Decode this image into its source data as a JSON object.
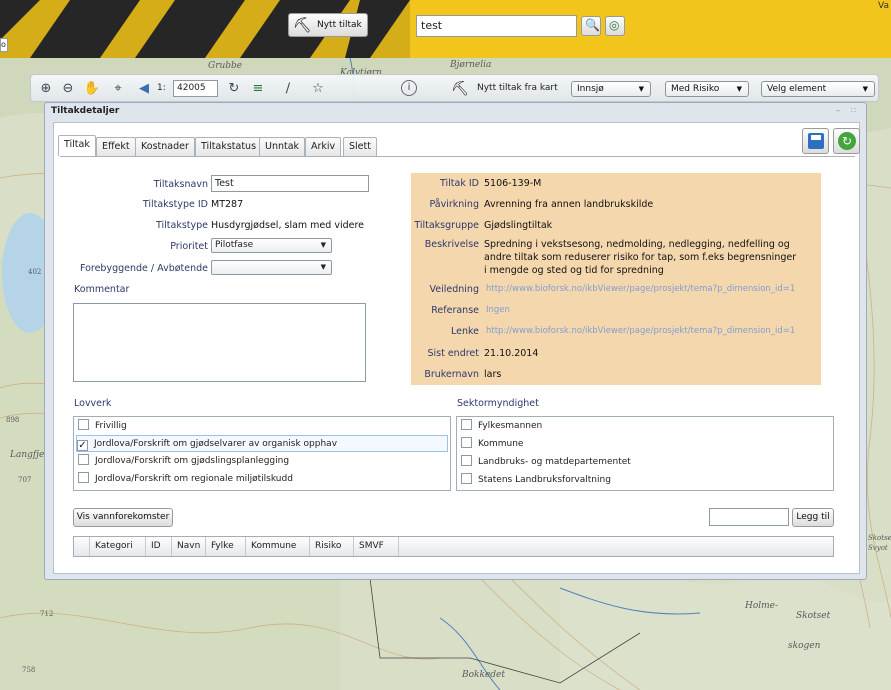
{
  "topbar": {
    "nytt_tiltak_label": "Nytt tiltak",
    "search_value": "test",
    "corner_text": "Va",
    "left_edge_text": "o"
  },
  "toolbar": {
    "scale_prefix": "1:",
    "scale_value": "42005",
    "nytt_tiltak_fra_kart_label": "Nytt tiltak fra kart",
    "dropdown_waterbody": "Innsjø",
    "dropdown_risk": "Med Risiko",
    "dropdown_element": "Velg element"
  },
  "map_labels": [
    "Grubbe",
    "Kalvtjørn",
    "Bjørnelia",
    "402",
    "898",
    "Langfjellet",
    "707",
    "Holme-",
    "Skotset",
    "skogen",
    "Bokkedet",
    "712",
    "758",
    "Skotsel",
    "Svyot"
  ],
  "panel": {
    "title": "Tiltakdetaljer",
    "tabs": [
      "Tiltak",
      "Effekt",
      "Kostnader",
      "Tiltakstatus",
      "Unntak",
      "Arkiv",
      "Slett"
    ]
  },
  "form": {
    "tiltaksnavn_label": "Tiltaksnavn",
    "tiltaksnavn_value": "Test",
    "tiltakstype_id_label": "Tiltakstype ID",
    "tiltakstype_id_value": "MT287",
    "tiltakstype_label": "Tiltakstype",
    "tiltakstype_value": "Husdyrgjødsel, slam med videre",
    "prioritet_label": "Prioritet",
    "prioritet_value": "Pilotfase",
    "forebyggende_label": "Forebyggende / Avbøtende",
    "forebyggende_value": "",
    "kommentar_label": "Kommentar"
  },
  "info": {
    "tiltak_id_label": "Tiltak ID",
    "tiltak_id_value": "5106-139-M",
    "pavirkning_label": "Påvirkning",
    "pavirkning_value": "Avrenning fra annen landbrukskilde",
    "tiltaksgruppe_label": "Tiltaksgruppe",
    "tiltaksgruppe_value": "Gjødslingtiltak",
    "beskrivelse_label": "Beskrivelse",
    "beskrivelse_line1": "Spredning i vekstsesong, nedmolding, nedlegging, nedfelling og",
    "beskrivelse_line2": "andre tiltak som reduserer risiko for tap, som f.eks begrensninger",
    "beskrivelse_line3": "i mengde og sted og tid for spredning",
    "veiledning_label": "Veiledning",
    "veiledning_value": "http://www.bioforsk.no/ikbViewer/page/prosjekt/tema?p_dimension_id=1",
    "referanse_label": "Referanse",
    "referanse_value": "Ingen",
    "lenke_label": "Lenke",
    "lenke_value": "http://www.bioforsk.no/ikbViewer/page/prosjekt/tema?p_dimension_id=1",
    "sist_endret_label": "Sist endret",
    "sist_endret_value": "21.10.2014",
    "brukernavn_label": "Brukernavn",
    "brukernavn_value": "lars"
  },
  "lovverk": {
    "title": "Lovverk",
    "items": [
      {
        "label": "Frivillig",
        "checked": false
      },
      {
        "label": "Jordlova/Forskrift om gjødselvarer av organisk opphav",
        "checked": true
      },
      {
        "label": "Jordlova/Forskrift om gjødslingsplanlegging",
        "checked": false
      },
      {
        "label": "Jordlova/Forskrift om regionale miljøtilskudd",
        "checked": false
      }
    ]
  },
  "sektor": {
    "title": "Sektormyndighet",
    "items": [
      {
        "label": "Fylkesmannen",
        "checked": false
      },
      {
        "label": "Kommune",
        "checked": false
      },
      {
        "label": "Landbruks- og matdepartementet",
        "checked": false
      },
      {
        "label": "Statens Landbruksforvaltning",
        "checked": false
      }
    ]
  },
  "bottom": {
    "vis_label": "Vis vannforekomster",
    "legg_til_label": "Legg til",
    "legg_til_value": "",
    "columns": [
      "Kategori",
      "ID",
      "Navn",
      "Fylke",
      "Kommune",
      "Risiko",
      "SMVF"
    ]
  },
  "colors": {
    "top_yellow": "#f2c51c",
    "info_bg": "#f5d7ae",
    "label_blue": "#2b3a6b",
    "link_blue": "#7f9fd0"
  }
}
